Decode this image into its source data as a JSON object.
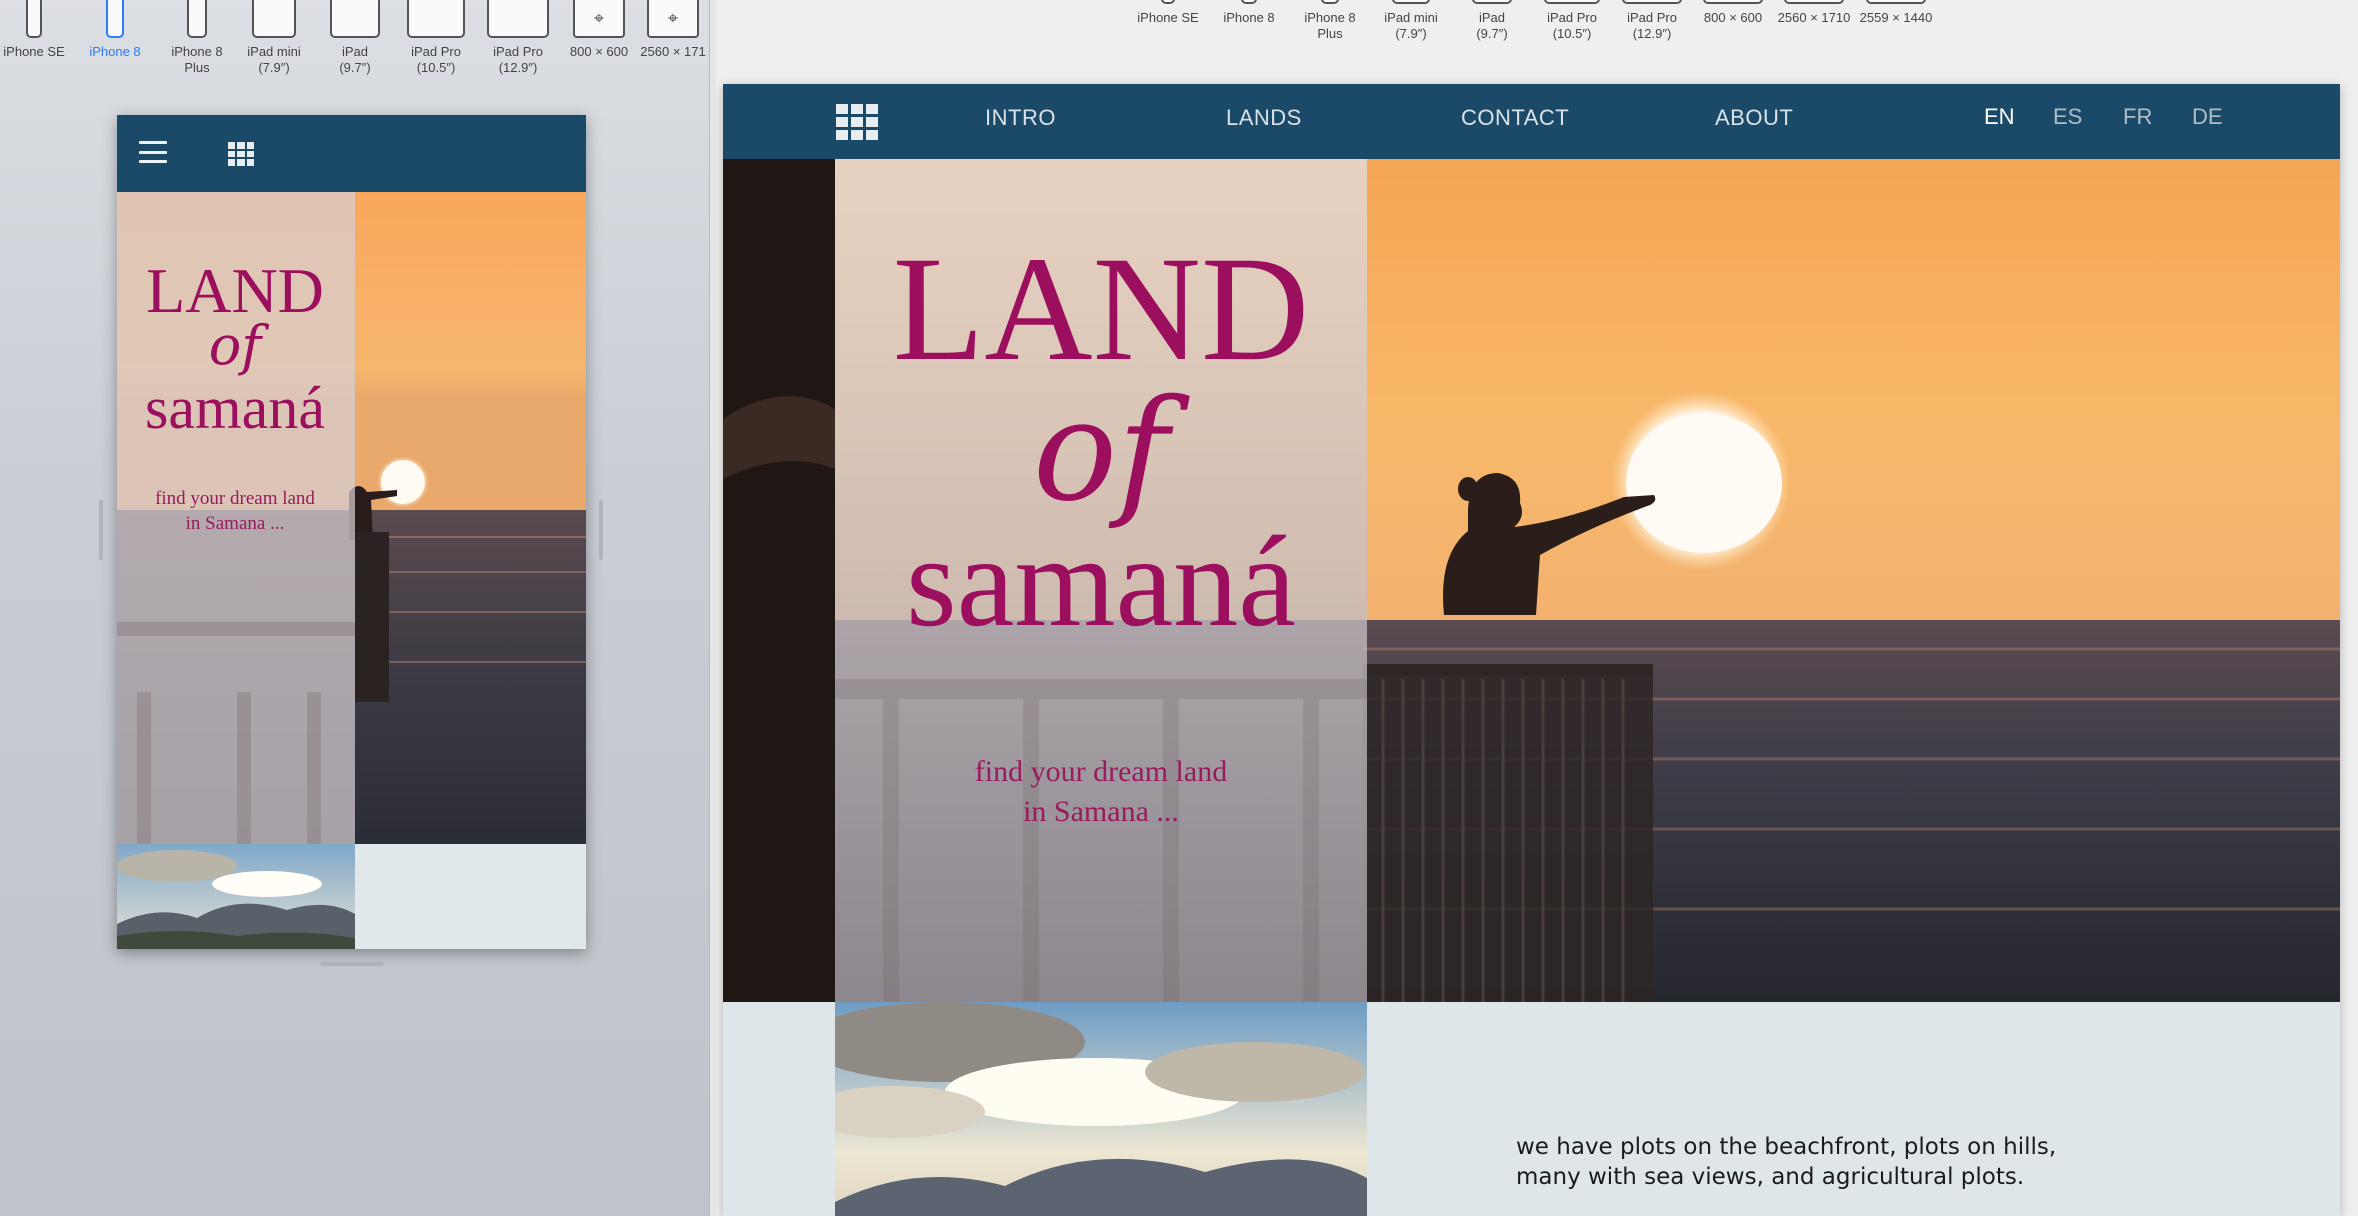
{
  "devices": [
    {
      "label": "iPhone SE",
      "selected": false
    },
    {
      "label": "iPhone 8",
      "selected": true
    },
    {
      "label": "iPhone 8 Plus",
      "selected": false
    },
    {
      "label": "iPad mini (7.9″)",
      "selected": false
    },
    {
      "label": "iPad (9.7″)",
      "selected": false
    },
    {
      "label": "iPad Pro (10.5″)",
      "selected": false
    },
    {
      "label": "iPad Pro (12.9″)",
      "selected": false
    },
    {
      "label": "800 × 600",
      "selected": false
    },
    {
      "label": "2560 × 171",
      "selected": false
    }
  ],
  "devices_right": [
    "iPhone SE",
    "iPhone 8",
    "iPhone 8 Plus",
    "iPad mini (7.9″)",
    "iPad (9.7″)",
    "iPad Pro (10.5″)",
    "iPad Pro (12.9″)",
    "800 × 600",
    "2560 × 1710",
    "2559 × 1440"
  ],
  "site": {
    "nav": [
      "INTRO",
      "LANDS",
      "CONTACT",
      "ABOUT"
    ],
    "languages": [
      "EN",
      "ES",
      "FR",
      "DE"
    ],
    "active_language": "EN",
    "title_line1": "LAND",
    "title_line2": "of",
    "title_line3": "samaná",
    "tagline_line1": "find your dream land",
    "tagline_line2": "in Samana ...",
    "description": "we have plots on the beachfront, plots on hills, many with sea views, and agricultural plots."
  },
  "colors": {
    "nav_bg": "#1b4a69",
    "title": "#9b0f5e",
    "selected_device": "#2b7cf5"
  }
}
